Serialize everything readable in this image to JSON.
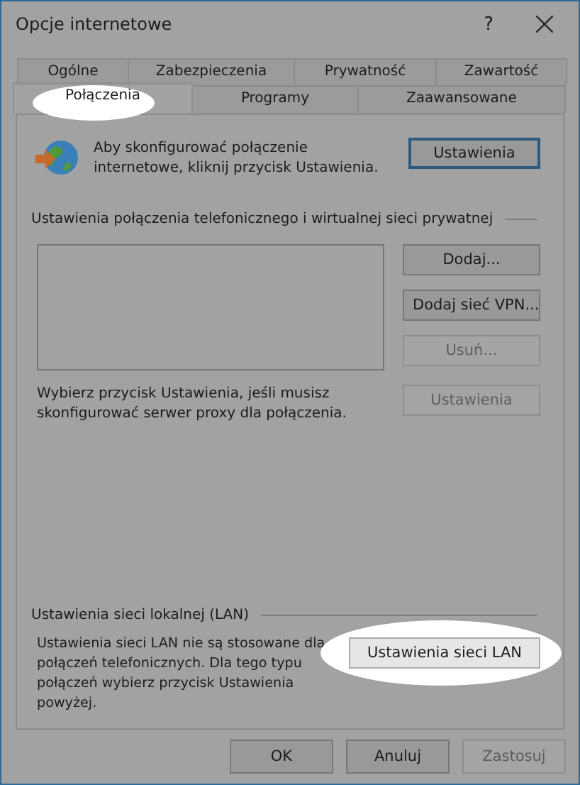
{
  "window": {
    "title": "Opcje internetowe",
    "help": "?"
  },
  "tab_rows": [
    [
      {
        "label": "Ogólne",
        "selected": false,
        "highlighted": false
      },
      {
        "label": "Zabezpieczenia",
        "selected": false,
        "highlighted": false
      },
      {
        "label": "Prywatność",
        "selected": false,
        "highlighted": false
      },
      {
        "label": "Zawartość",
        "selected": false,
        "highlighted": false
      }
    ],
    [
      {
        "label": "Połączenia",
        "selected": true,
        "highlighted": true
      },
      {
        "label": "Programy",
        "selected": false,
        "highlighted": false
      },
      {
        "label": "Zaawansowane",
        "selected": false,
        "highlighted": false
      }
    ]
  ],
  "intro": {
    "text": "Aby skonfigurować połączenie internetowe, kliknij przycisk Ustawienia.",
    "button": {
      "label": "Ustawienia",
      "disabled": false,
      "default": true
    }
  },
  "dialup": {
    "heading": "Ustawienia połączenia telefonicznego i wirtualnej sieci prywatnej",
    "buttons": [
      {
        "label": "Dodaj...",
        "disabled": false
      },
      {
        "label": "Dodaj sieć VPN...",
        "disabled": false
      },
      {
        "label": "Usuń...",
        "disabled": true
      }
    ],
    "proxy_text": "Wybierz przycisk Ustawienia, jeśli musisz skonfigurować serwer proxy dla połączenia.",
    "proxy_button": {
      "label": "Ustawienia",
      "disabled": true
    }
  },
  "lan": {
    "heading": "Ustawienia sieci lokalnej (LAN)",
    "text": "Ustawienia sieci LAN nie są stosowane dla połączeń telefonicznych. Dla tego typu połączeń wybierz przycisk Ustawienia powyżej.",
    "button": {
      "label": "Ustawienia sieci LAN",
      "disabled": false,
      "highlighted": true
    }
  },
  "footer_buttons": [
    {
      "label": "OK",
      "disabled": false
    },
    {
      "label": "Anuluj",
      "disabled": false
    },
    {
      "label": "Zastosuj",
      "disabled": true
    }
  ]
}
